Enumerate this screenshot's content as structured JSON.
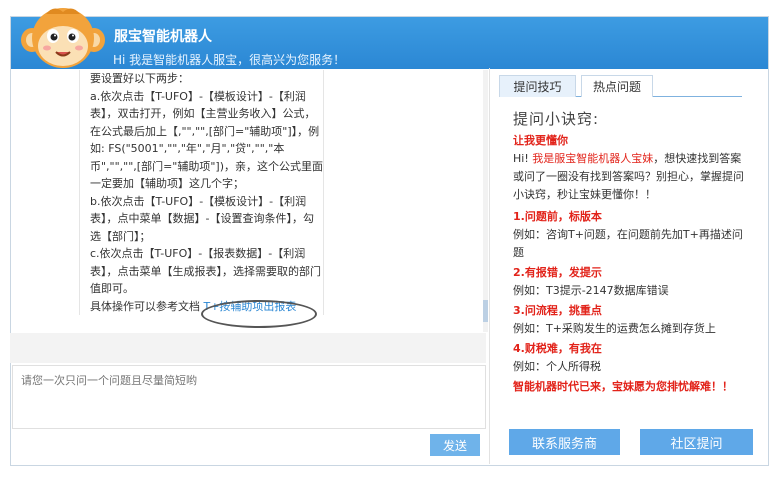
{
  "header": {
    "title": "服宝智能机器人",
    "subtitle": "Hi 我是智能机器人服宝，很高兴为您服务！"
  },
  "chat": {
    "lines": [
      "要设置好以下两步：",
      "a.依次点击【T-UFO】-【模板设计】-【利润表】，双击打开，例如【主营业务收入】公式，在公式最后加上【,\"\",\"\",[部门=\"辅助项\"]】，例如: FS(\"5001\",\"\",\"年\",\"月\",\"贷\",\"\",\"本币\",\"\",\"\",[部门=\"辅助项\"])，亲，这个公式里面一定要加【辅助项】这几个字；",
      "b.依次点击【T-UFO】-【模板设计】-【利润表】，点中菜单【数据】-【设置查询条件】，勾选【部门】；",
      "c.依次点击【T-UFO】-【报表数据】-【利润表】，点击菜单【生成报表】，选择需要取的部门值即可。"
    ],
    "doc_prefix": "具体操作可以参考文档",
    "doc_link": "T+按辅助项出报表"
  },
  "input": {
    "placeholder": "请您一次只问一个问题且尽量简短哟"
  },
  "send_label": "发送",
  "tabs": [
    {
      "label": "提问技巧"
    },
    {
      "label": "热点问题"
    }
  ],
  "tips": {
    "title": "提问小诀窍:",
    "heading": "让我更懂你",
    "intro_prefix": "Hi! ",
    "intro_highlight": "我是服宝智能机器人宝妹",
    "intro_rest": "，想快速找到答案或问了一圈没有找到答案吗？别担心，掌握提问小诀窍，秒让宝妹更懂你！！",
    "items": [
      {
        "heading": "1.问题前，标版本",
        "example": "例如：咨询T+问题，在问题前先加T+再描述问题"
      },
      {
        "heading": "2.有报错，发提示",
        "example": "例如：T3提示-2147数据库错误"
      },
      {
        "heading": "3.问流程，挑重点",
        "example": "例如：T+采购发生的运费怎么摊到存货上"
      },
      {
        "heading": "4.财税难，有我在",
        "example": "例如：个人所得税"
      }
    ],
    "footer": "智能机器时代已来，宝妹愿为您排忧解难！！"
  },
  "buttons": {
    "contact": "联系服务商",
    "community": "社区提问"
  },
  "colors": {
    "header_blue": "#2b87d4",
    "accent_red": "#e2231a",
    "button_blue": "#5fa8e8"
  }
}
